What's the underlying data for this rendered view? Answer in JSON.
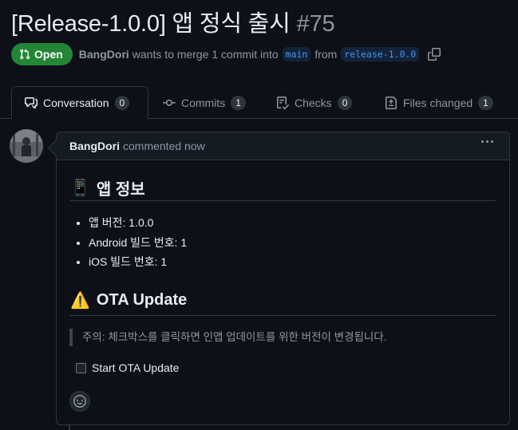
{
  "pr": {
    "title": "[Release-1.0.0] 앱 정식 출시",
    "number": "#75",
    "state": "Open",
    "author": "BangDori",
    "merge_text": "wants to merge 1 commit into",
    "base_branch": "main",
    "from_text": "from",
    "head_branch": "release-1.0.0"
  },
  "tabs": [
    {
      "label": "Conversation",
      "count": "0"
    },
    {
      "label": "Commits",
      "count": "1"
    },
    {
      "label": "Checks",
      "count": "0"
    },
    {
      "label": "Files changed",
      "count": "1"
    }
  ],
  "comment": {
    "author": "BangDori",
    "action": "commented now",
    "section1": {
      "emoji": "📱",
      "heading": "앱 정보"
    },
    "items": [
      "앱 버전: 1.0.0",
      "Android 빌드 번호: 1",
      "iOS 빌드 번호: 1"
    ],
    "section2": {
      "emoji": "⚠️",
      "heading": "OTA Update"
    },
    "quote": "주의: 체크박스를 클릭하면 인앱 업데이트를 위한 버전이 변경됩니다.",
    "task": {
      "label": "Start OTA Update",
      "checked": false
    }
  },
  "colors": {
    "open_badge": "#238636",
    "background": "#0d1117",
    "link_blue": "#4493f8"
  },
  "icons": [
    "git-pull-request-icon",
    "copy-icon",
    "comment-discussion-icon",
    "git-commit-icon",
    "checklist-icon",
    "file-diff-icon",
    "kebab-horizontal-icon",
    "smiley-icon"
  ]
}
